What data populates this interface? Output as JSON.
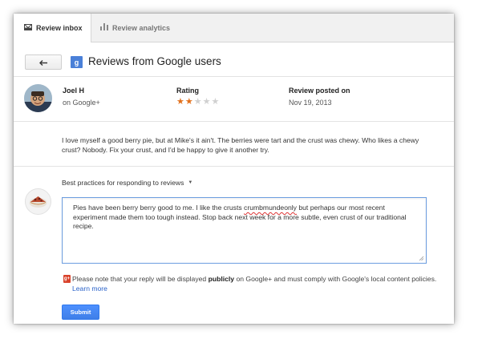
{
  "tabs": [
    {
      "label": "Review inbox",
      "icon": "envelope-icon",
      "active": true
    },
    {
      "label": "Review analytics",
      "icon": "bar-chart-icon",
      "active": false
    }
  ],
  "header": {
    "back_icon": "back-arrow-icon",
    "badge_icon": "google-plus-icon",
    "badge_text": "g",
    "title": "Reviews from Google users"
  },
  "review": {
    "author_name": "Joel H",
    "author_source": "on Google+",
    "rating_label": "Rating",
    "rating_value": 2,
    "rating_max": 5,
    "date_label": "Review posted on",
    "date_value": "Nov 19, 2013",
    "text": "I love myself a good berry pie, but at Mike's it ain't. The berries were tart and the crust was chewy. Who likes a chewy crust? Nobody. Fix your crust, and I'd be happy to give it another try."
  },
  "reply": {
    "best_practices_label": "Best practices for responding to reviews",
    "text_before": "Pies have been berry berry good to me. I like the crusts ",
    "misspelled_word": "crumbmundeonly",
    "text_after": " but perhaps our most recent experiment made them too tough instead. Stop back next week for a more subtle, even crust of our traditional recipe."
  },
  "notice": {
    "icon_text": "g+",
    "prefix": "Please note that your reply will be displayed ",
    "bold": "publicly",
    "suffix": " on Google+ and must comply with Google's local content policies. ",
    "link": "Learn more"
  },
  "submit_label": "Submit",
  "colors": {
    "accent_blue": "#4d90fe",
    "star_on": "#e2711d",
    "star_off": "#d0d0d0",
    "gplus_red": "#d9422b",
    "link_blue": "#2a62c9"
  }
}
